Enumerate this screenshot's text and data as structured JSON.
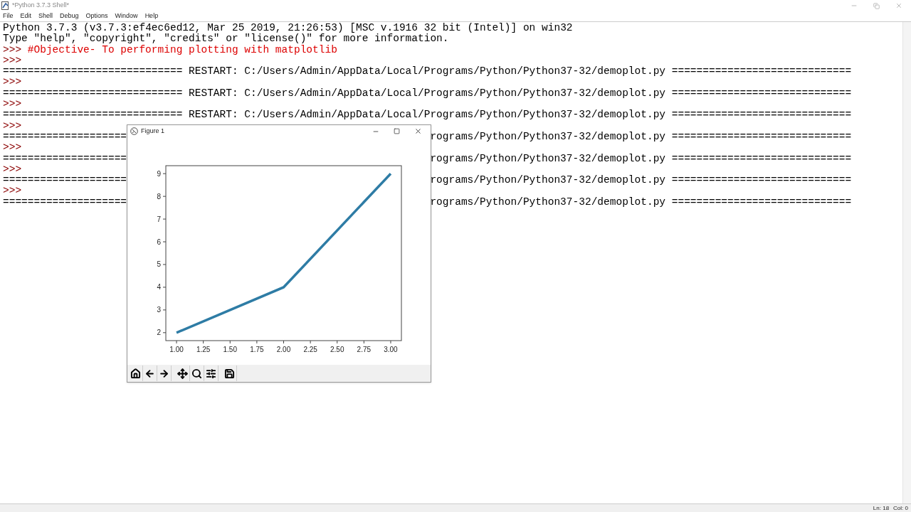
{
  "window": {
    "title": "*Python 3.7.3 Shell*"
  },
  "menu": [
    "File",
    "Edit",
    "Shell",
    "Debug",
    "Options",
    "Window",
    "Help"
  ],
  "shell": {
    "lines": [
      {
        "kind": "output",
        "text": "Python 3.7.3 (v3.7.3:ef4ec6ed12, Mar 25 2019, 21:26:53) [MSC v.1916 32 bit (Intel)] on win32"
      },
      {
        "kind": "output",
        "text": "Type \"help\", \"copyright\", \"credits\" or \"license()\" for more information."
      },
      {
        "kind": "prompt",
        "prompt": ">>>",
        "text": "#Objective- To performing plotting with matplotlib"
      },
      {
        "kind": "prompt",
        "prompt": ">>>"
      },
      {
        "kind": "restart",
        "text": "============================= RESTART: C:/Users/Admin/AppData/Local/Programs/Python/Python37-32/demoplot.py ============================="
      },
      {
        "kind": "prompt",
        "prompt": ">>>"
      },
      {
        "kind": "restart",
        "text": "============================= RESTART: C:/Users/Admin/AppData/Local/Programs/Python/Python37-32/demoplot.py ============================="
      },
      {
        "kind": "prompt",
        "prompt": ">>>"
      },
      {
        "kind": "restart",
        "text": "============================= RESTART: C:/Users/Admin/AppData/Local/Programs/Python/Python37-32/demoplot.py ============================="
      },
      {
        "kind": "prompt",
        "prompt": ">>>"
      },
      {
        "kind": "covered",
        "left": "====================",
        "right": "rograms/Python/Python37-32/demoplot.py ============================="
      },
      {
        "kind": "prompt",
        "prompt": ">>>"
      },
      {
        "kind": "covered",
        "left": "====================",
        "right": "rograms/Python/Python37-32/demoplot.py ============================="
      },
      {
        "kind": "prompt",
        "prompt": ">>>"
      },
      {
        "kind": "covered",
        "left": "====================",
        "right": "rograms/Python/Python37-32/demoplot.py ============================="
      },
      {
        "kind": "prompt",
        "prompt": ">>>"
      },
      {
        "kind": "covered",
        "left": "====================",
        "right": "rograms/Python/Python37-32/demoplot.py ============================="
      }
    ]
  },
  "figure": {
    "title": "Figure 1",
    "chart_data": {
      "type": "line",
      "x": [
        1,
        2,
        3
      ],
      "series": [
        {
          "color": "#2e7ca5",
          "values": [
            2,
            4,
            9
          ]
        }
      ],
      "xlim": [
        0.9,
        3.1
      ],
      "ylim": [
        1.65,
        9.35
      ],
      "xticks": [
        {
          "value": 1,
          "label": "1.00"
        },
        {
          "value": 1.25,
          "label": "1.25"
        },
        {
          "value": 1.5,
          "label": "1.50"
        },
        {
          "value": 1.75,
          "label": "1.75"
        },
        {
          "value": 2,
          "label": "2.00"
        },
        {
          "value": 2.25,
          "label": "2.25"
        },
        {
          "value": 2.5,
          "label": "2.50"
        },
        {
          "value": 2.75,
          "label": "2.75"
        },
        {
          "value": 3,
          "label": "3.00"
        }
      ],
      "yticks": [
        2,
        3,
        4,
        5,
        6,
        7,
        8,
        9
      ]
    },
    "toolbar": [
      {
        "kind": "home"
      },
      {
        "kind": "back"
      },
      {
        "kind": "forward"
      },
      {
        "kind": "sep"
      },
      {
        "kind": "pan"
      },
      {
        "kind": "zoom"
      },
      {
        "kind": "configure"
      },
      {
        "kind": "sep"
      },
      {
        "kind": "save"
      }
    ]
  },
  "status_bar": {
    "line": "Ln: 18",
    "col": "Col: 0"
  }
}
